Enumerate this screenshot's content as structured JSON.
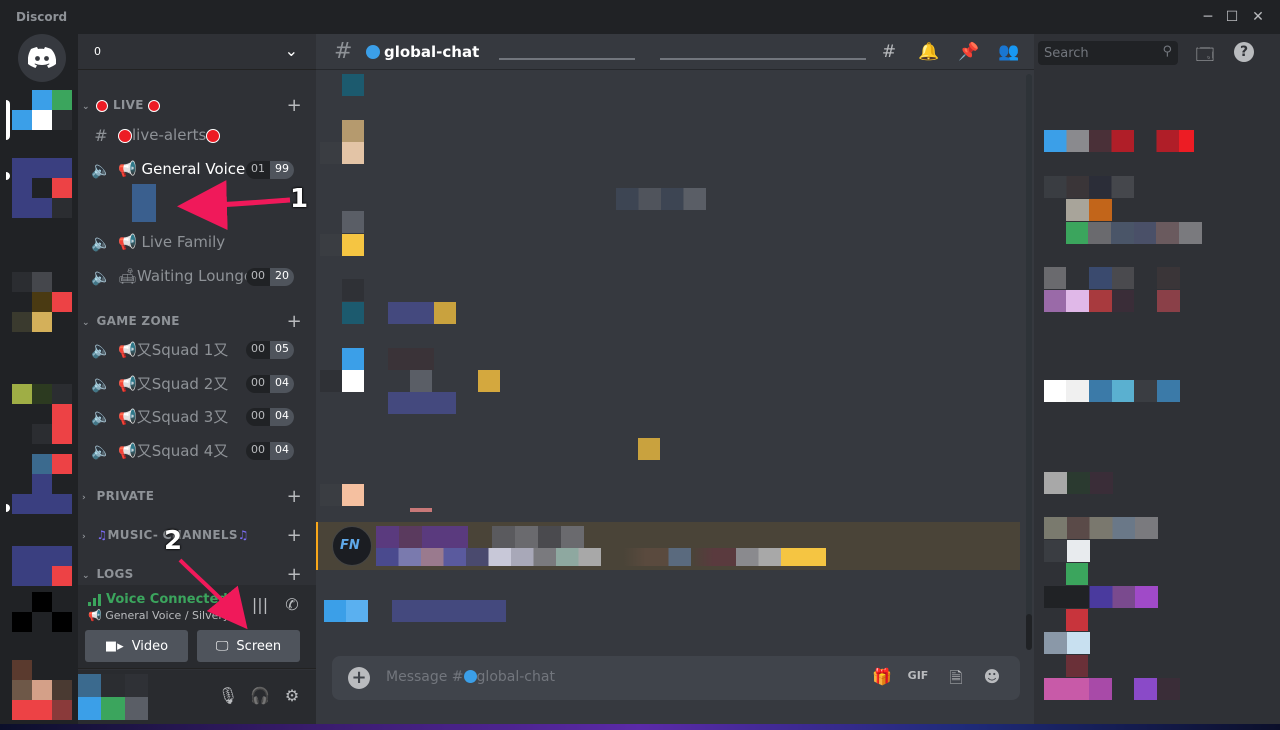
{
  "window": {
    "title": "Discord",
    "controls": [
      "minimize",
      "maximize",
      "close"
    ]
  },
  "guild": {
    "name_initial": "0",
    "header_chevron": "chevron-down-icon"
  },
  "categories": {
    "live": "LIVE",
    "game_zone": "GAME ZONE",
    "private": "PRIVATE",
    "music": "MUSIC- CHANNELS",
    "logs": "LOGS"
  },
  "channels": {
    "live_alerts": "live-alerts",
    "general_voice": "General Voice",
    "general_voice_count": [
      "01",
      "99"
    ],
    "live_family": "Live Family",
    "waiting_lounge": "Waiting Lounge...",
    "waiting_lounge_count": [
      "00",
      "20"
    ],
    "squads": [
      {
        "name": "又Squad 1又",
        "count": [
          "00",
          "05"
        ]
      },
      {
        "name": "又Squad 2又",
        "count": [
          "00",
          "04"
        ]
      },
      {
        "name": "又Squad 3又",
        "count": [
          "00",
          "04"
        ]
      },
      {
        "name": "又Squad 4又",
        "count": [
          "00",
          "04"
        ]
      }
    ]
  },
  "voice_panel": {
    "status": "Voice Connected",
    "location": "General Voice / Silvery ...",
    "video_label": "Video",
    "screen_label": "Screen"
  },
  "chat": {
    "channel_name": "global-chat",
    "composer_placeholder_prefix": "Message #",
    "composer_placeholder_channel": "global-chat",
    "gif_label": "GIF"
  },
  "search": {
    "placeholder": "Search"
  },
  "annotations": {
    "step1": "1",
    "step2": "2"
  },
  "colors": {
    "accent_red": "#ed1c24",
    "annotation_arrow": "#f0195a",
    "voice_connected": "#3ba55d",
    "highlight_border": "#faa81a"
  }
}
